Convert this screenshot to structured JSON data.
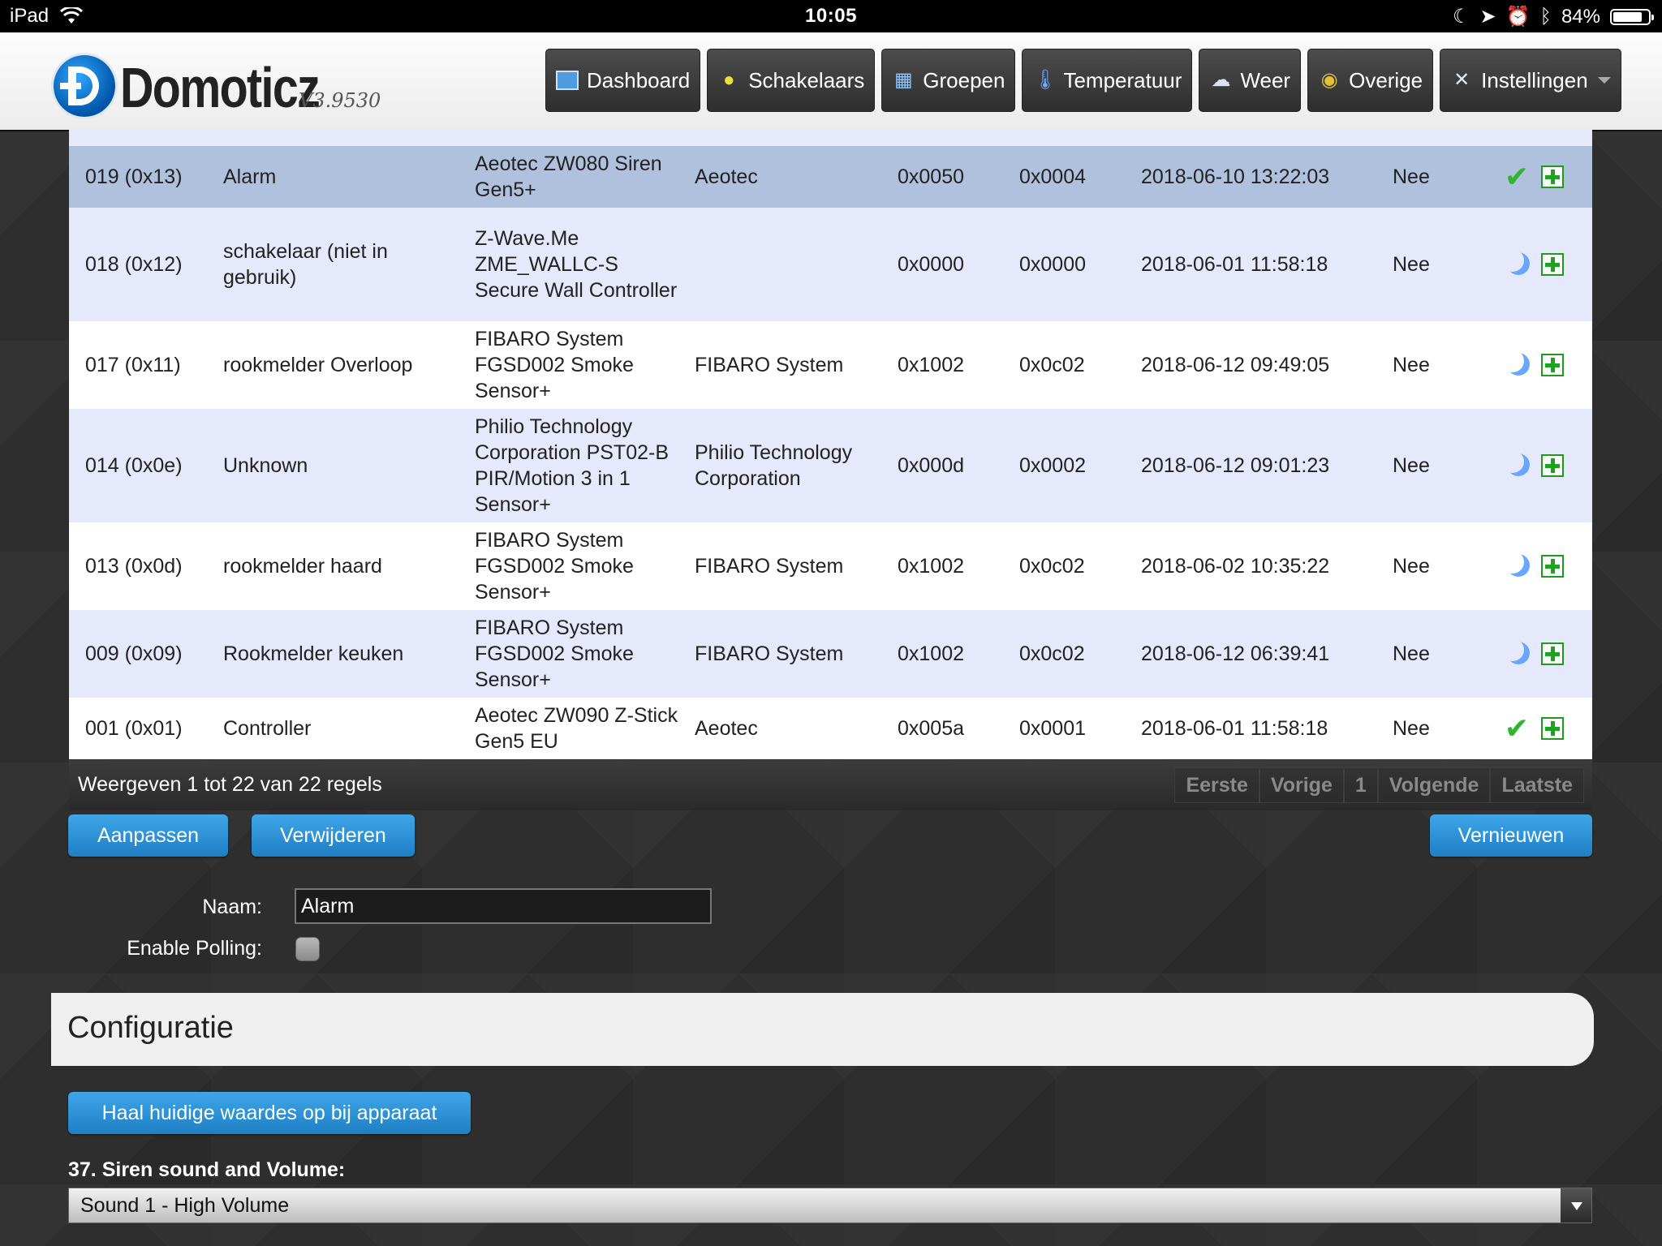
{
  "status_bar": {
    "device": "iPad",
    "time": "10:05",
    "battery": "84%",
    "battery_level": 0.84
  },
  "header": {
    "app_name": "Domoticz",
    "version": "V3.9530",
    "nav": [
      {
        "label": "Dashboard",
        "icon": "dashboard-icon"
      },
      {
        "label": "Schakelaars",
        "icon": "lightbulb-icon"
      },
      {
        "label": "Groepen",
        "icon": "clapperboard-icon"
      },
      {
        "label": "Temperatuur",
        "icon": "thermometer-icon"
      },
      {
        "label": "Weer",
        "icon": "cloud-rain-icon"
      },
      {
        "label": "Overige",
        "icon": "globe-icon"
      },
      {
        "label": "Instellingen",
        "icon": "tools-icon"
      }
    ]
  },
  "table": {
    "rows": [
      {
        "node": "019 (0x13)",
        "name": "Alarm",
        "description": "Aeotec ZW080 Siren Gen5+",
        "manufacturer": "Aeotec",
        "product_id": "0x0050",
        "product_type": "0x0004",
        "last_seen": "2018-06-10 13:22:03",
        "polling": "Nee",
        "state": "check",
        "selected": true,
        "bg": "#afc1dd"
      },
      {
        "node": "018 (0x12)",
        "name": "schakelaar (niet in gebruik)",
        "description": "Z-Wave.Me ZME_WALLC-S Secure Wall Controller",
        "manufacturer": "",
        "product_id": "0x0000",
        "product_type": "0x0000",
        "last_seen": "2018-06-01 11:58:18",
        "polling": "Nee",
        "state": "sleep",
        "selected": false,
        "bg": "#e6e8fb"
      },
      {
        "node": "017 (0x11)",
        "name": "rookmelder Overloop",
        "description": "FIBARO System FGSD002 Smoke Sensor+",
        "manufacturer": "FIBARO System",
        "product_id": "0x1002",
        "product_type": "0x0c02",
        "last_seen": "2018-06-12 09:49:05",
        "polling": "Nee",
        "state": "sleep",
        "selected": false,
        "bg": "#ffffff"
      },
      {
        "node": "014 (0x0e)",
        "name": "Unknown",
        "description": "Philio Technology Corporation PST02-B PIR/Motion 3 in 1 Sensor+",
        "manufacturer": "Philio Technology Corporation",
        "product_id": "0x000d",
        "product_type": "0x0002",
        "last_seen": "2018-06-12 09:01:23",
        "polling": "Nee",
        "state": "sleep",
        "selected": false,
        "bg": "#e6e8fb"
      },
      {
        "node": "013 (0x0d)",
        "name": "rookmelder haard",
        "description": "FIBARO System FGSD002 Smoke Sensor+",
        "manufacturer": "FIBARO System",
        "product_id": "0x1002",
        "product_type": "0x0c02",
        "last_seen": "2018-06-02 10:35:22",
        "polling": "Nee",
        "state": "sleep",
        "selected": false,
        "bg": "#ffffff"
      },
      {
        "node": "009 (0x09)",
        "name": "Rookmelder keuken",
        "description": "FIBARO System FGSD002 Smoke Sensor+",
        "manufacturer": "FIBARO System",
        "product_id": "0x1002",
        "product_type": "0x0c02",
        "last_seen": "2018-06-12 06:39:41",
        "polling": "Nee",
        "state": "sleep",
        "selected": false,
        "bg": "#e6e8fb"
      },
      {
        "node": "001 (0x01)",
        "name": "Controller",
        "description": "Aeotec ZW090 Z-Stick Gen5 EU",
        "manufacturer": "Aeotec",
        "product_id": "0x005a",
        "product_type": "0x0001",
        "last_seen": "2018-06-01 11:58:18",
        "polling": "Nee",
        "state": "check",
        "selected": false,
        "bg": "#ffffff"
      }
    ],
    "info": "Weergeven 1 tot 22 van 22 regels",
    "pager": {
      "first": "Eerste",
      "prev": "Vorige",
      "page": "1",
      "next": "Volgende",
      "last": "Laatste"
    }
  },
  "actions": {
    "edit": "Aanpassen",
    "delete": "Verwijderen",
    "refresh": "Vernieuwen"
  },
  "form": {
    "name_label": "Naam:",
    "name_value": "Alarm",
    "polling_label": "Enable Polling:"
  },
  "config": {
    "title": "Configuratie",
    "fetch_button": "Haal huidige waardes op bij apparaat",
    "param_label": "37. Siren sound and Volume:",
    "param_value": "Sound 1 - High Volume"
  }
}
